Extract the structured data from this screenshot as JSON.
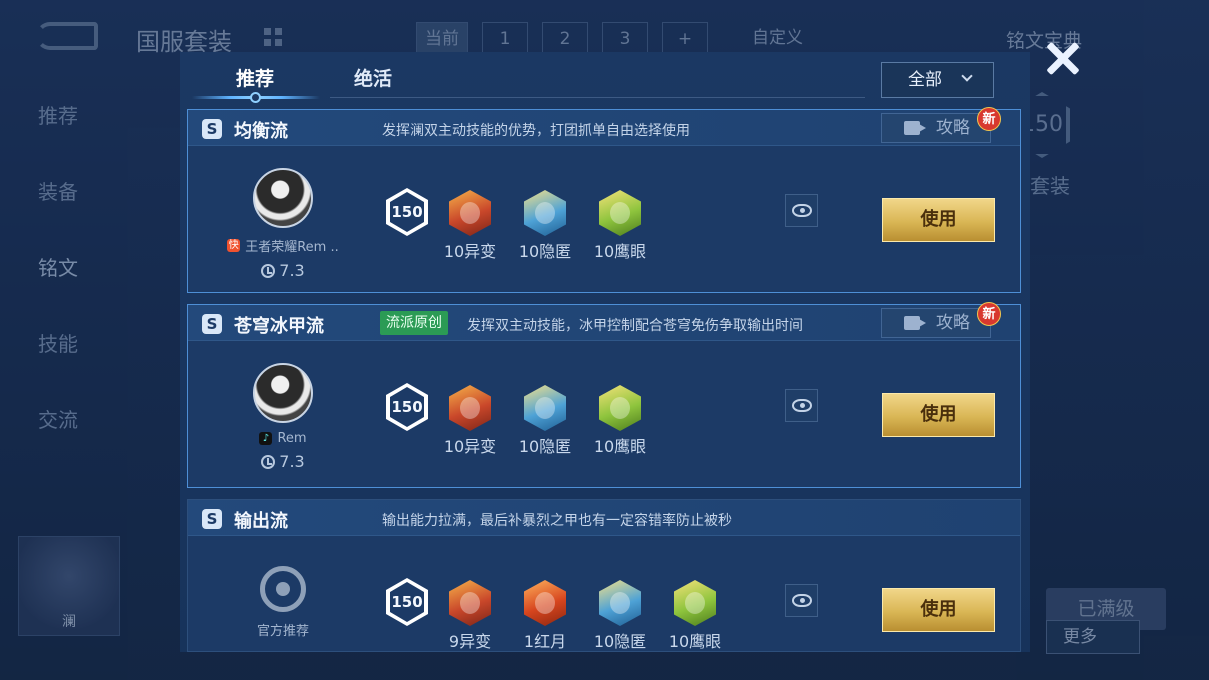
{
  "background": {
    "title": "国服套装",
    "slots": [
      "当前",
      "1",
      "2",
      "3",
      "+"
    ],
    "custom_label": "自定义",
    "treasure_label": "铭文宝典",
    "sidebar": [
      "推荐",
      "装备",
      "铭文",
      "技能",
      "交流"
    ],
    "hero_name": "澜",
    "right_badge_level": "150",
    "right_label": "国服套装",
    "full_level_label": "已满级",
    "more_label": "更多"
  },
  "tabs": [
    {
      "label": "推荐",
      "active": true
    },
    {
      "label": "绝活",
      "active": false
    }
  ],
  "filter_label": "全部",
  "cards": [
    {
      "name": "均衡流",
      "original_tag": "",
      "description": "发挥澜双主动技能的优势，打团抓单自由选择使用",
      "guide_label": "攻略",
      "is_new": true,
      "new_label": "新",
      "author": "王者荣耀Rem ..",
      "author_platform": "kuaishou",
      "rating": "7.3",
      "level": "150",
      "runes": [
        {
          "label": "10异变",
          "color": "red"
        },
        {
          "label": "10隐匿",
          "color": "blue"
        },
        {
          "label": "10鹰眼",
          "color": "green"
        }
      ],
      "use_label": "使用"
    },
    {
      "name": "苍穹冰甲流",
      "original_tag": "流派原创",
      "description": "发挥双主动技能，冰甲控制配合苍穹免伤争取输出时间",
      "guide_label": "攻略",
      "is_new": true,
      "new_label": "新",
      "author": "Rem",
      "author_platform": "douyin",
      "rating": "7.3",
      "level": "150",
      "runes": [
        {
          "label": "10异变",
          "color": "red"
        },
        {
          "label": "10隐匿",
          "color": "blue"
        },
        {
          "label": "10鹰眼",
          "color": "green"
        }
      ],
      "use_label": "使用"
    },
    {
      "name": "输出流",
      "original_tag": "",
      "description": "输出能力拉满，最后补暴烈之甲也有一定容错率防止被秒",
      "guide_label": "",
      "is_new": false,
      "author": "官方推荐",
      "author_platform": "official",
      "rating": "",
      "level": "150",
      "runes": [
        {
          "label": "9异变",
          "color": "red"
        },
        {
          "label": "1红月",
          "color": "crimson"
        },
        {
          "label": "10隐匿",
          "color": "blue"
        },
        {
          "label": "10鹰眼",
          "color": "green"
        }
      ],
      "use_label": "使用"
    }
  ]
}
